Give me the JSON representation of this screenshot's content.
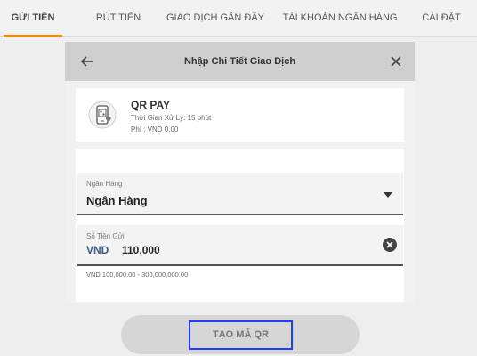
{
  "tabs": [
    {
      "label": "GỬI TIỀN",
      "active": true
    },
    {
      "label": "RÚT TIỀN",
      "active": false
    },
    {
      "label": "GIAO DỊCH GẦN ĐÂY",
      "active": false
    },
    {
      "label": "TÀI KHOẢN NGÂN HÀNG",
      "active": false
    },
    {
      "label": "CÀI ĐẶT",
      "active": false
    }
  ],
  "header": {
    "title": "Nhập Chi Tiết Giao Dịch",
    "back_icon": "arrow-left-icon",
    "close_icon": "close-icon"
  },
  "method": {
    "icon": "qr-phone-icon",
    "name": "QR PAY",
    "processing_time": "Thời Gian Xử Lý: 15 phút",
    "fee": "Phí : VND 0.00"
  },
  "bank_field": {
    "label": "Ngân Hàng",
    "value": "Ngân Hàng"
  },
  "amount_field": {
    "label": "Số Tiền Gửi",
    "currency": "VND",
    "value": "110,000",
    "range_hint": "VND 100,000.00 - 300,000,000.00"
  },
  "submit": {
    "label": "TẠO MÃ QR"
  },
  "colors": {
    "accent": "#f08a00",
    "highlight_border": "#1f3cff",
    "currency": "#3a5d8a"
  }
}
